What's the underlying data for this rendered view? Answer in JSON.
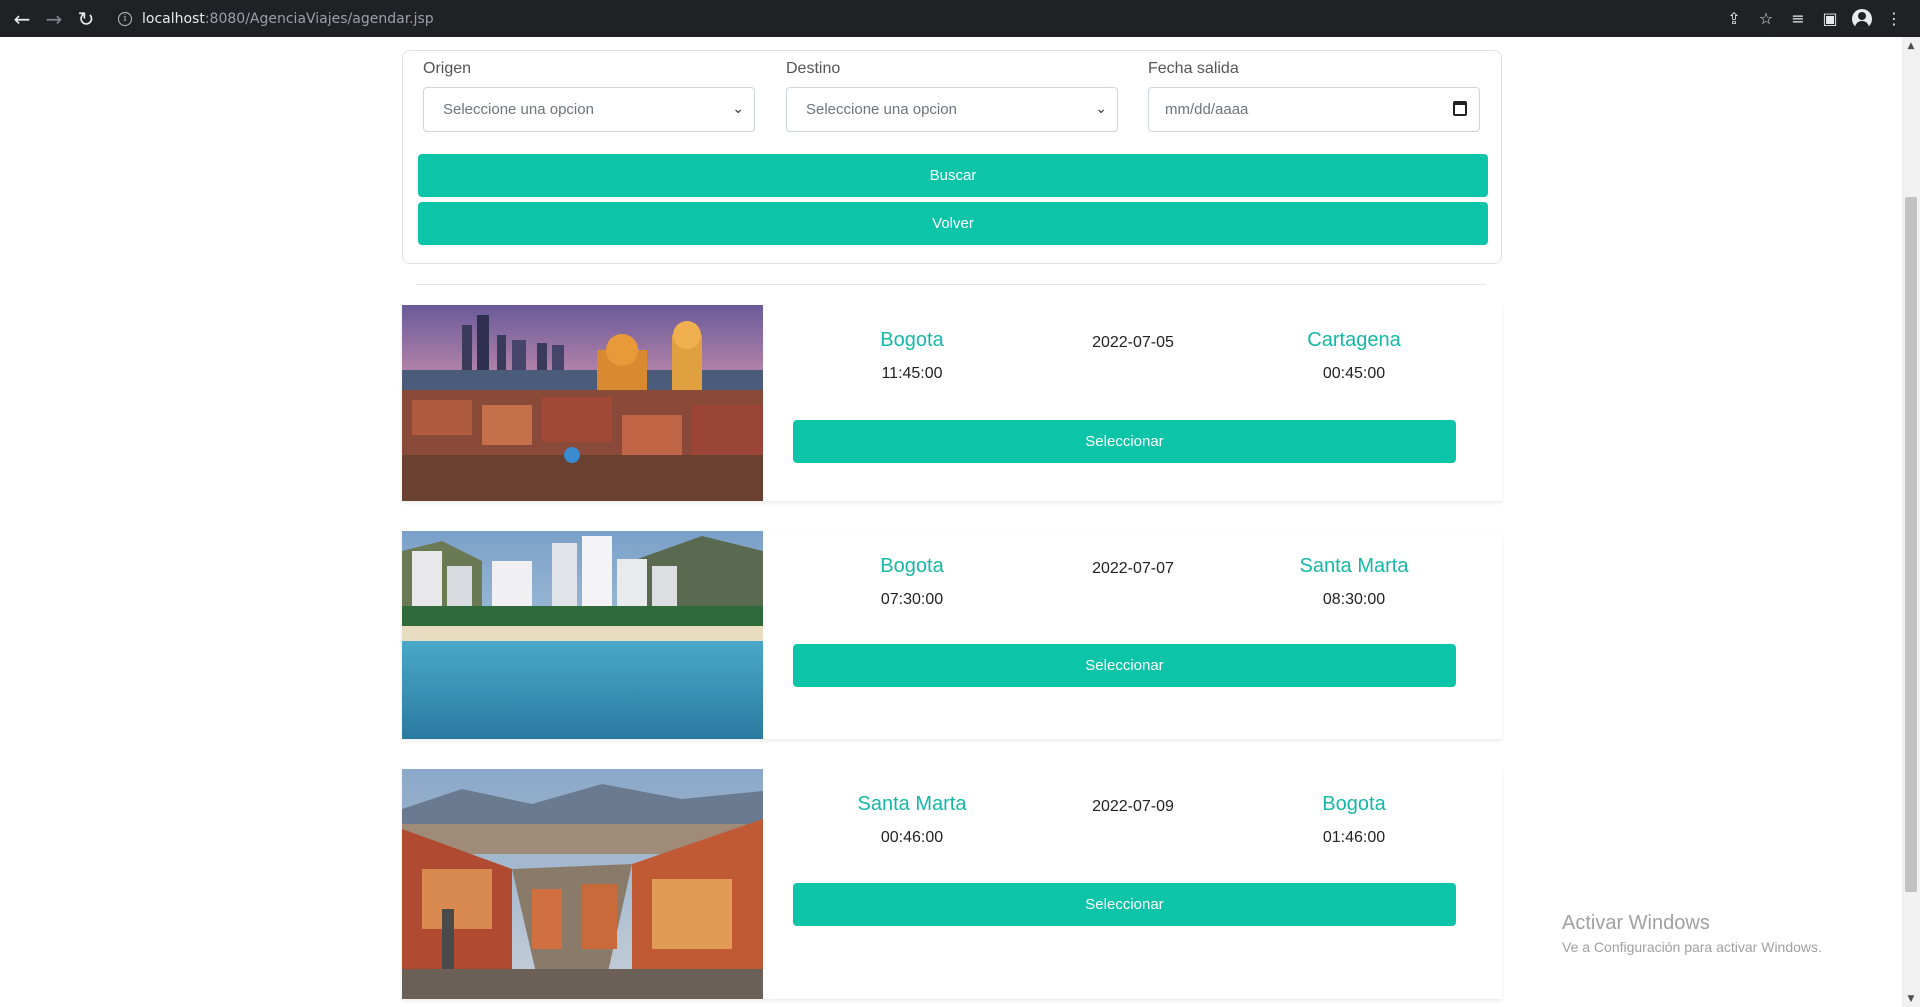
{
  "browser": {
    "url_host": "localhost",
    "url_rest": ":8080/AgenciaViajes/agendar.jsp"
  },
  "form": {
    "origen_label": "Origen",
    "origen_placeholder": "Seleccione una opcion",
    "destino_label": "Destino",
    "destino_placeholder": "Seleccione una opcion",
    "fecha_label": "Fecha salida",
    "fecha_placeholder": "mm/dd/aaaa",
    "buscar_label": "Buscar",
    "volver_label": "Volver"
  },
  "trips": [
    {
      "origin": "Bogota",
      "departure": "11:45:00",
      "date": "2022-07-05",
      "destination": "Cartagena",
      "arrival": "00:45:00",
      "button": "Seleccionar"
    },
    {
      "origin": "Bogota",
      "departure": "07:30:00",
      "date": "2022-07-07",
      "destination": "Santa Marta",
      "arrival": "08:30:00",
      "button": "Seleccionar"
    },
    {
      "origin": "Santa Marta",
      "departure": "00:46:00",
      "date": "2022-07-09",
      "destination": "Bogota",
      "arrival": "01:46:00",
      "button": "Seleccionar"
    }
  ],
  "watermark": {
    "title": "Activar Windows",
    "subtitle": "Ve a Configuración para activar Windows."
  },
  "colors": {
    "accent": "#0cc4a8",
    "city_text": "#16b8a5",
    "chrome_bg": "#202124"
  }
}
